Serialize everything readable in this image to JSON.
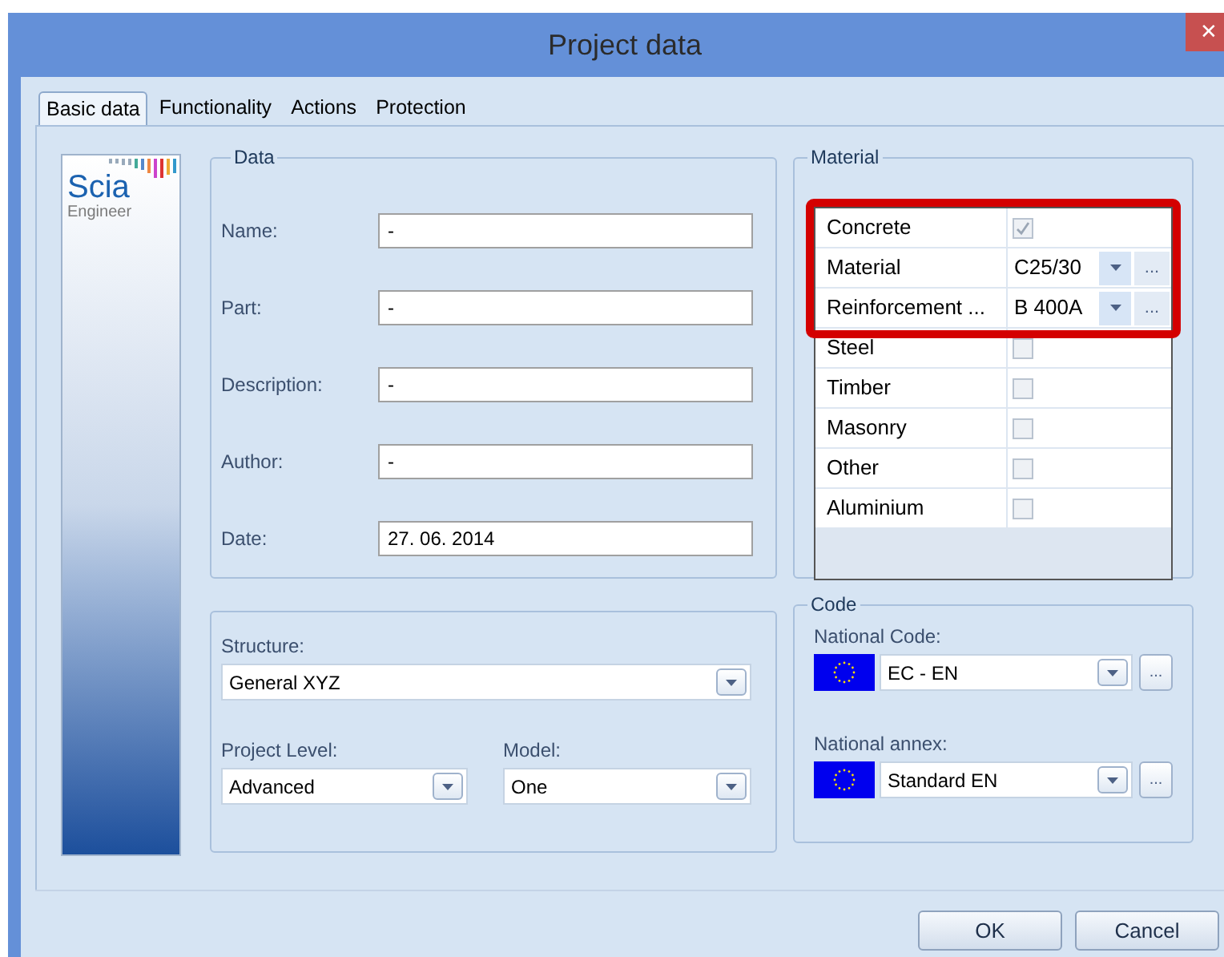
{
  "window": {
    "title": "Project data",
    "close": "✕"
  },
  "tabs": [
    {
      "label": "Basic data",
      "selected": true
    },
    {
      "label": "Functionality",
      "selected": false
    },
    {
      "label": "Actions",
      "selected": false
    },
    {
      "label": "Protection",
      "selected": false
    }
  ],
  "logo": {
    "name": "Scia",
    "tagline": "Engineer"
  },
  "data": {
    "title": "Data",
    "fields": [
      {
        "label": "Name:",
        "value": "-"
      },
      {
        "label": "Part:",
        "value": "-"
      },
      {
        "label": "Description:",
        "value": "-"
      },
      {
        "label": "Author:",
        "value": "-"
      },
      {
        "label": "Date:",
        "value": "27. 06. 2014"
      }
    ]
  },
  "structure": {
    "structure": {
      "label": "Structure:",
      "value": "General XYZ"
    },
    "project_level": {
      "label": "Project Level:",
      "value": "Advanced"
    },
    "model": {
      "label": "Model:",
      "value": "One"
    }
  },
  "material": {
    "title": "Material",
    "rows": [
      {
        "label": "Concrete",
        "kind": "checkbox",
        "checked": true,
        "disabled": true,
        "highlighted": true
      },
      {
        "label": "Material",
        "kind": "combo",
        "value": "C25/30",
        "more": "...",
        "highlighted": true
      },
      {
        "label": "Reinforcement ...",
        "kind": "combo",
        "value": "B 400A",
        "more": "...",
        "highlighted": true
      },
      {
        "label": "Steel",
        "kind": "checkbox",
        "checked": false,
        "disabled": true,
        "highlighted": false
      },
      {
        "label": "Timber",
        "kind": "checkbox",
        "checked": false,
        "disabled": true,
        "highlighted": false
      },
      {
        "label": "Masonry",
        "kind": "checkbox",
        "checked": false,
        "disabled": true,
        "highlighted": false
      },
      {
        "label": "Other",
        "kind": "checkbox",
        "checked": false,
        "disabled": true,
        "highlighted": false
      },
      {
        "label": "Aluminium",
        "kind": "checkbox",
        "checked": false,
        "disabled": true,
        "highlighted": false
      }
    ]
  },
  "code": {
    "title": "Code",
    "fields": [
      {
        "label": "National Code:",
        "value": "EC - EN",
        "more": "..."
      },
      {
        "label": "National annex:",
        "value": "Standard EN",
        "more": "..."
      }
    ]
  },
  "buttons": [
    "OK",
    "Cancel"
  ]
}
